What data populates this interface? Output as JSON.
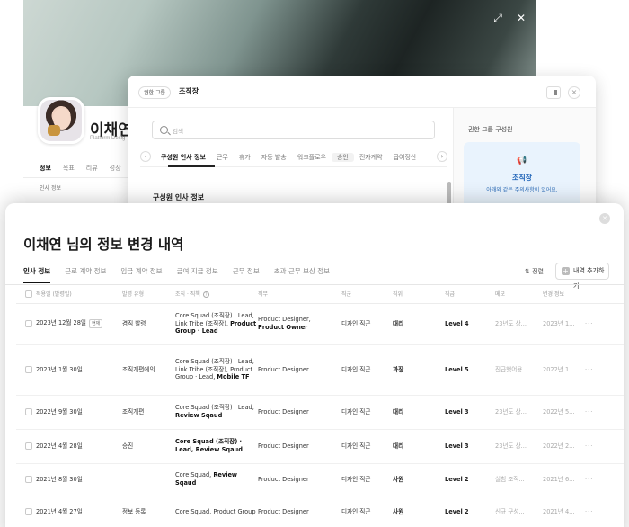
{
  "profile": {
    "name": "이채연",
    "subtitle": "Platform Desig",
    "tabs": [
      "정보",
      "목표",
      "리뷰",
      "성장"
    ],
    "subtab": "인사 정보"
  },
  "dialog": {
    "chip": "권한 그룹",
    "title": "조직장",
    "search_placeholder": "검색",
    "tabs": [
      "구성원 인사 정보",
      "근무",
      "휴가",
      "자동 발송",
      "워크플로우",
      "승인",
      "전자계약",
      "급여정산"
    ],
    "section_title": "구성원 인사 정보",
    "right_title": "권한 그룹 구성원",
    "notice": {
      "title": "조직장",
      "text": "아래와 같은 주의사항이 있어요."
    }
  },
  "history": {
    "title": "이채연 님의 정보 변경 내역",
    "tabs": [
      "인사 정보",
      "근로 계약 정보",
      "임금 계약 정보",
      "급여 지급 정보",
      "근무 정보",
      "초과 근무 보상 정보"
    ],
    "sort_label": "정렬",
    "add_button": "내역 추가하기",
    "columns": [
      "적용일 (발령일)",
      "발령 유형",
      "조직 · 직책",
      "직무",
      "직군",
      "직위",
      "직급",
      "메모",
      "변경 정보"
    ],
    "rows": [
      {
        "date": "2023년 12월 28일",
        "badge": "현재",
        "type": "겸직 발령",
        "org_plain": "Core Squad (조직장) · Lead, Link Tribe (조직장),",
        "org_bold": "Product Group · Lead",
        "job_plain": "Product Designer,",
        "job_bold": "Product Owner",
        "group": "디자인 직군",
        "position": "대리",
        "level": "Level 4",
        "memo": "23년도 상...",
        "change": "2023년 1..."
      },
      {
        "date": "2023년 1월 30일",
        "badge": "",
        "type": "조직개편에의...",
        "org_plain": "Core Squad (조직장) · Lead, Link Tribe (조직장), Product Group · Lead,",
        "org_bold": "Mobile TF",
        "job_plain": "Product Designer",
        "job_bold": "",
        "group": "디자인 직군",
        "position": "과장",
        "level": "Level 5",
        "memo": "진급했어용",
        "change": "2022년 1..."
      },
      {
        "date": "2022년 9월 30일",
        "badge": "",
        "type": "조직개편",
        "org_plain": "Core Squad (조직장) · Lead,",
        "org_bold": "Review Sqaud",
        "job_plain": "Product Designer",
        "job_bold": "",
        "group": "디자인 직군",
        "position": "대리",
        "level": "Level 3",
        "memo": "23년도 상...",
        "change": "2022년 5..."
      },
      {
        "date": "2022년 4월 28일",
        "badge": "",
        "type": "승진",
        "org_plain": "",
        "org_bold": "Core Squad (조직장) · Lead, Review Sqaud",
        "job_plain": "Product Designer",
        "job_bold": "",
        "group": "디자인 직군",
        "position": "대리",
        "level": "Level 3",
        "memo": "23년도 상...",
        "change": "2022년 2..."
      },
      {
        "date": "2021년 8월 30일",
        "badge": "",
        "type": "",
        "org_plain": "Core Squad,",
        "org_bold": "Review Sqaud",
        "job_plain": "Product Designer",
        "job_bold": "",
        "group": "디자인 직군",
        "position": "사원",
        "level": "Level 2",
        "memo": "실험 조직...",
        "change": "2021년 6..."
      },
      {
        "date": "2021년 4월 27일",
        "badge": "",
        "type": "정보 등록",
        "org_plain": "Core Squad, Product Group",
        "org_bold": "",
        "job_plain": "Product Designer",
        "job_bold": "",
        "group": "디자인 직군",
        "position": "사원",
        "level": "Level 2",
        "memo": "신규 구성...",
        "change": "2021년 4..."
      }
    ]
  }
}
